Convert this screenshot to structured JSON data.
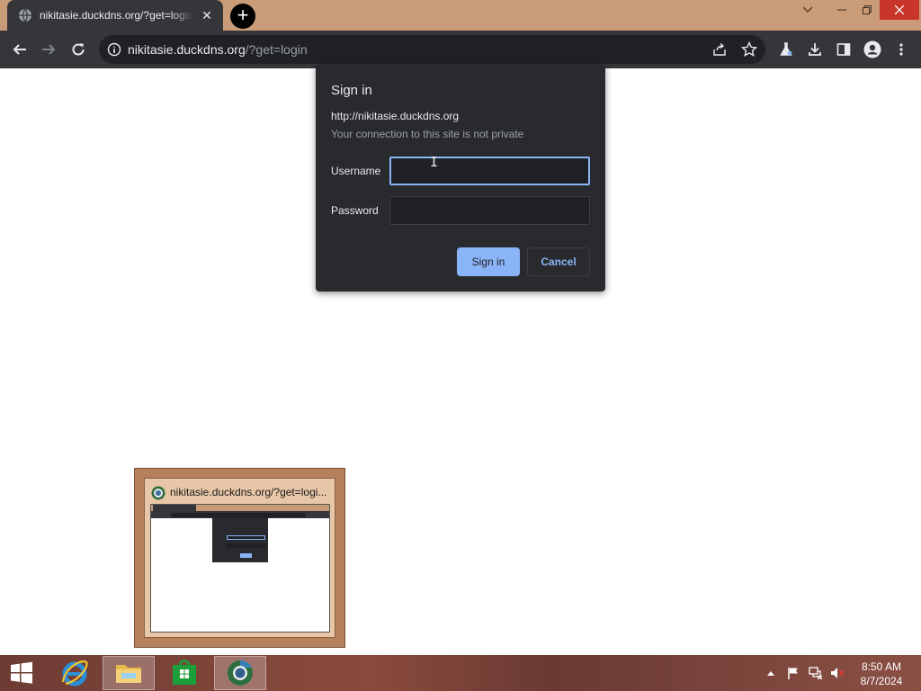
{
  "browser": {
    "tab": {
      "title": "nikitasie.duckdns.org/?get=login",
      "close_glyph": "✕"
    },
    "new_tab_glyph": "+",
    "omnibox": {
      "host": "nikitasie.duckdns.org",
      "path": "/?get=login"
    }
  },
  "dialog": {
    "title": "Sign in",
    "origin": "http://nikitasie.duckdns.org",
    "warning": "Your connection to this site is not private",
    "username_label": "Username",
    "username_value": "",
    "password_label": "Password",
    "password_value": "",
    "signin_label": "Sign in",
    "cancel_label": "Cancel"
  },
  "thumbnail": {
    "title": "nikitasie.duckdns.org/?get=logi..."
  },
  "taskbar": {
    "apps": [
      "internet-explorer-icon",
      "file-explorer-icon",
      "windows-store-icon",
      "chrome-icon"
    ],
    "clock": {
      "time": "8:50 AM",
      "date": "8/7/2024"
    }
  },
  "colors": {
    "tabstrip": "#c99b77",
    "toolbar": "#35363a",
    "dialog_bg": "#292a2d",
    "accent": "#8ab4f8",
    "close_button": "#c7352b"
  }
}
